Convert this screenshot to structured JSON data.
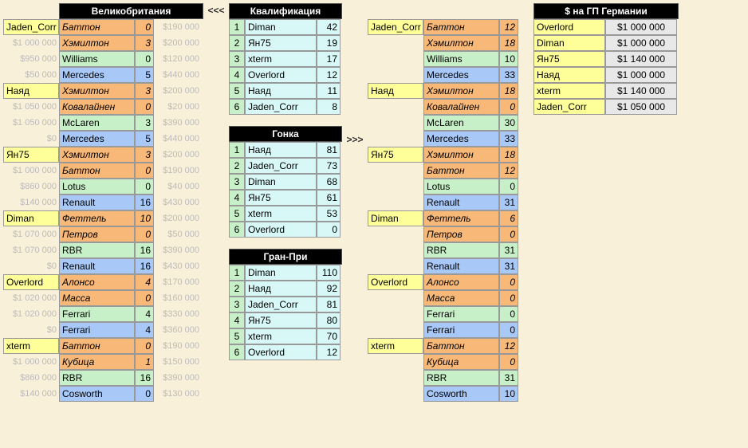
{
  "gb_header": "Великобритания",
  "arrow_left": "<<<",
  "arrow_right": ">>>",
  "qual_header": "Квалификация",
  "race_header": "Гонка",
  "gp_header": "Гран-При",
  "right_untitled": "",
  "money_header": "$ на ГП Германии",
  "gb": [
    {
      "player": "Jaden_Corr",
      "r": [
        {
          "ml": "",
          "n": "Баттон",
          "p": 0,
          "mr": "$190 000",
          "c": "driver1"
        },
        {
          "ml": "$1 000 000",
          "n": "Хэмилтон",
          "p": 3,
          "mr": "$200 000",
          "c": "driver2"
        },
        {
          "ml": "$950 000",
          "n": "Williams",
          "p": 0,
          "mr": "$120 000",
          "c": "team1"
        },
        {
          "ml": "$50 000",
          "n": "Mercedes",
          "p": 5,
          "mr": "$440 000",
          "c": "team2"
        }
      ]
    },
    {
      "player": "Наяд",
      "r": [
        {
          "ml": "",
          "n": "Хэмилтон",
          "p": 3,
          "mr": "$200 000",
          "c": "driver1"
        },
        {
          "ml": "$1 050 000",
          "n": "Ковалайнен",
          "p": 0,
          "mr": "$20 000",
          "c": "driver2"
        },
        {
          "ml": "$1 050 000",
          "n": "McLaren",
          "p": 3,
          "mr": "$390 000",
          "c": "team1"
        },
        {
          "ml": "$0",
          "n": "Mercedes",
          "p": 5,
          "mr": "$440 000",
          "c": "team2"
        }
      ]
    },
    {
      "player": "Ян75",
      "r": [
        {
          "ml": "",
          "n": "Хэмилтон",
          "p": 3,
          "mr": "$200 000",
          "c": "driver1"
        },
        {
          "ml": "$1 000 000",
          "n": "Баттон",
          "p": 0,
          "mr": "$190 000",
          "c": "driver2"
        },
        {
          "ml": "$860 000",
          "n": "Lotus",
          "p": 0,
          "mr": "$40 000",
          "c": "team1"
        },
        {
          "ml": "$140 000",
          "n": "Renault",
          "p": 16,
          "mr": "$430 000",
          "c": "team2"
        }
      ]
    },
    {
      "player": "Diman",
      "r": [
        {
          "ml": "",
          "n": "Феттель",
          "p": 10,
          "mr": "$200 000",
          "c": "driver1"
        },
        {
          "ml": "$1 070 000",
          "n": "Петров",
          "p": 0,
          "mr": "$50 000",
          "c": "driver2"
        },
        {
          "ml": "$1 070 000",
          "n": "RBR",
          "p": 16,
          "mr": "$390 000",
          "c": "team1"
        },
        {
          "ml": "$0",
          "n": "Renault",
          "p": 16,
          "mr": "$430 000",
          "c": "team2"
        }
      ]
    },
    {
      "player": "Overlord",
      "r": [
        {
          "ml": "",
          "n": "Алонсо",
          "p": 4,
          "mr": "$170 000",
          "c": "driver1"
        },
        {
          "ml": "$1 020 000",
          "n": "Масса",
          "p": 0,
          "mr": "$160 000",
          "c": "driver2"
        },
        {
          "ml": "$1 020 000",
          "n": "Ferrari",
          "p": 4,
          "mr": "$330 000",
          "c": "team1"
        },
        {
          "ml": "$0",
          "n": "Ferrari",
          "p": 4,
          "mr": "$360 000",
          "c": "team2"
        }
      ]
    },
    {
      "player": "xterm",
      "r": [
        {
          "ml": "",
          "n": "Баттон",
          "p": 0,
          "mr": "$190 000",
          "c": "driver1"
        },
        {
          "ml": "$1 000 000",
          "n": "Кубица",
          "p": 1,
          "mr": "$150 000",
          "c": "driver2"
        },
        {
          "ml": "$860 000",
          "n": "RBR",
          "p": 16,
          "mr": "$390 000",
          "c": "team1"
        },
        {
          "ml": "$140 000",
          "n": "Cosworth",
          "p": 0,
          "mr": "$130 000",
          "c": "team2"
        }
      ]
    }
  ],
  "right": [
    {
      "player": "Jaden_Corr",
      "r": [
        {
          "n": "Баттон",
          "p": 12,
          "c": "driver1"
        },
        {
          "n": "Хэмилтон",
          "p": 18,
          "c": "driver2"
        },
        {
          "n": "Williams",
          "p": 10,
          "c": "team1"
        },
        {
          "n": "Mercedes",
          "p": 33,
          "c": "team2"
        }
      ]
    },
    {
      "player": "Наяд",
      "r": [
        {
          "n": "Хэмилтон",
          "p": 18,
          "c": "driver1"
        },
        {
          "n": "Ковалайнен",
          "p": 0,
          "c": "driver2"
        },
        {
          "n": "McLaren",
          "p": 30,
          "c": "team1"
        },
        {
          "n": "Mercedes",
          "p": 33,
          "c": "team2"
        }
      ]
    },
    {
      "player": "Ян75",
      "r": [
        {
          "n": "Хэмилтон",
          "p": 18,
          "c": "driver1"
        },
        {
          "n": "Баттон",
          "p": 12,
          "c": "driver2"
        },
        {
          "n": "Lotus",
          "p": 0,
          "c": "team1"
        },
        {
          "n": "Renault",
          "p": 31,
          "c": "team2"
        }
      ]
    },
    {
      "player": "Diman",
      "r": [
        {
          "n": "Феттель",
          "p": 6,
          "c": "driver1"
        },
        {
          "n": "Петров",
          "p": 0,
          "c": "driver2"
        },
        {
          "n": "RBR",
          "p": 31,
          "c": "team1"
        },
        {
          "n": "Renault",
          "p": 31,
          "c": "team2"
        }
      ]
    },
    {
      "player": "Overlord",
      "r": [
        {
          "n": "Алонсо",
          "p": 0,
          "c": "driver1"
        },
        {
          "n": "Масса",
          "p": 0,
          "c": "driver2"
        },
        {
          "n": "Ferrari",
          "p": 0,
          "c": "team1"
        },
        {
          "n": "Ferrari",
          "p": 0,
          "c": "team2"
        }
      ]
    },
    {
      "player": "xterm",
      "r": [
        {
          "n": "Баттон",
          "p": 12,
          "c": "driver1"
        },
        {
          "n": "Кубица",
          "p": 0,
          "c": "driver2"
        },
        {
          "n": "RBR",
          "p": 31,
          "c": "team1"
        },
        {
          "n": "Cosworth",
          "p": 10,
          "c": "team2"
        }
      ]
    }
  ],
  "qual": [
    {
      "rk": 1,
      "n": "Diman",
      "p": 42
    },
    {
      "rk": 2,
      "n": "Ян75",
      "p": 19
    },
    {
      "rk": 3,
      "n": "xterm",
      "p": 17
    },
    {
      "rk": 4,
      "n": "Overlord",
      "p": 12
    },
    {
      "rk": 5,
      "n": "Наяд",
      "p": 11
    },
    {
      "rk": 6,
      "n": "Jaden_Corr",
      "p": 8
    }
  ],
  "race": [
    {
      "rk": 1,
      "n": "Наяд",
      "p": 81
    },
    {
      "rk": 2,
      "n": "Jaden_Corr",
      "p": 73
    },
    {
      "rk": 3,
      "n": "Diman",
      "p": 68
    },
    {
      "rk": 4,
      "n": "Ян75",
      "p": 61
    },
    {
      "rk": 5,
      "n": "xterm",
      "p": 53
    },
    {
      "rk": 6,
      "n": "Overlord",
      "p": 0
    }
  ],
  "gp": [
    {
      "rk": 1,
      "n": "Diman",
      "p": 110
    },
    {
      "rk": 2,
      "n": "Наяд",
      "p": 92
    },
    {
      "rk": 3,
      "n": "Jaden_Corr",
      "p": 81
    },
    {
      "rk": 4,
      "n": "Ян75",
      "p": 80
    },
    {
      "rk": 5,
      "n": "xterm",
      "p": 70
    },
    {
      "rk": 6,
      "n": "Overlord",
      "p": 12
    }
  ],
  "money": [
    {
      "n": "Overlord",
      "v": "$1 000 000"
    },
    {
      "n": "Diman",
      "v": "$1 000 000"
    },
    {
      "n": "Ян75",
      "v": "$1 140 000"
    },
    {
      "n": "Наяд",
      "v": "$1 000 000"
    },
    {
      "n": "xterm",
      "v": "$1 140 000"
    },
    {
      "n": "Jaden_Corr",
      "v": "$1 050 000"
    }
  ]
}
